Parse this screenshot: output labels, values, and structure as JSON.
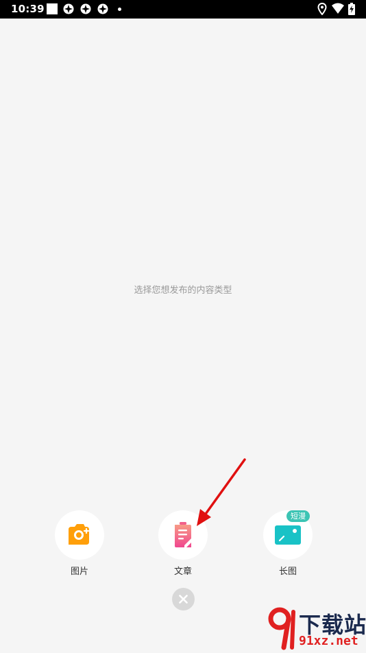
{
  "status_bar": {
    "time": "10:39"
  },
  "hint_text": "选择您想发布的内容类型",
  "options": [
    {
      "label": "图片",
      "icon": "camera-icon",
      "color": "#ff9f0a"
    },
    {
      "label": "文章",
      "icon": "document-edit-icon",
      "color": "#f2608a"
    },
    {
      "label": "长图",
      "icon": "image-icon",
      "color": "#19c2c6",
      "badge": "短漫"
    }
  ],
  "close_icon": "close-icon",
  "watermark": {
    "chinese": "下载站",
    "domain": "91xz.net"
  },
  "colors": {
    "background": "#f5f5f5",
    "badge": "#3cc4b4",
    "arrow": "#e01010"
  }
}
